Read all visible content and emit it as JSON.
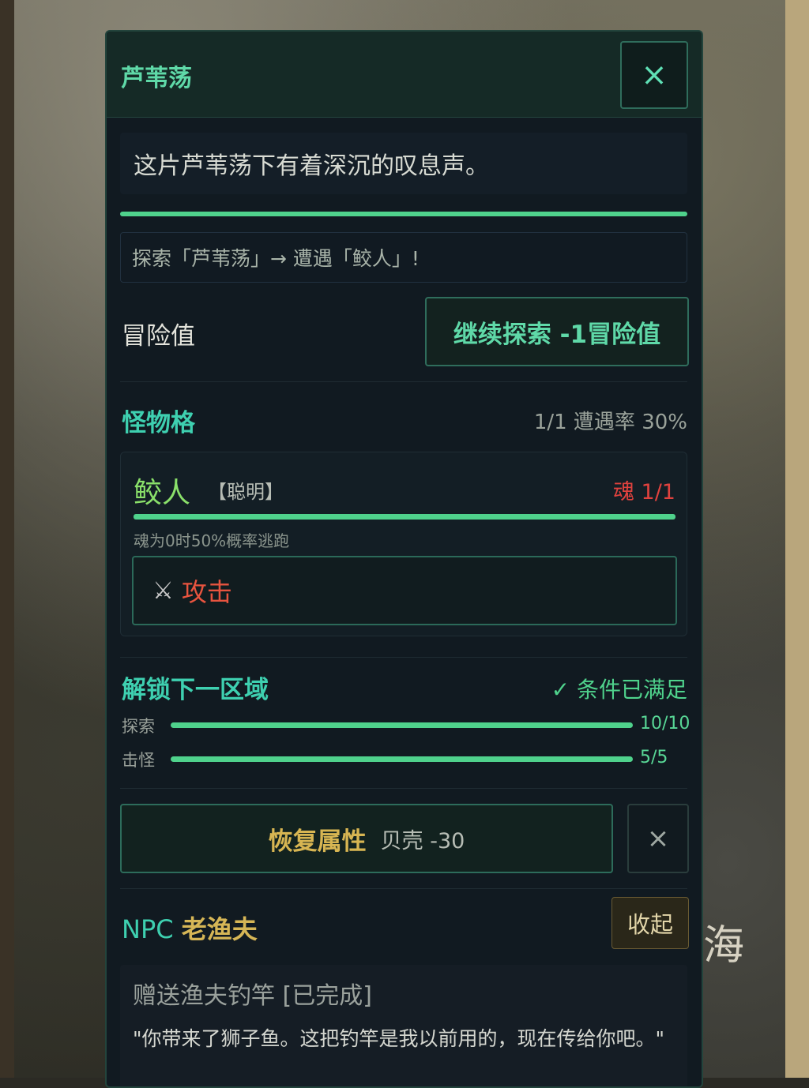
{
  "background": {
    "sea_glyph": "海"
  },
  "panel": {
    "title": "芦苇荡",
    "close_icon": "×",
    "description": "这片芦苇荡下有着深沉的叹息声。",
    "log": "探索「芦苇荡」→ 遭遇「鲛人」!",
    "adventure_label": "冒险值",
    "continue_button": "继续探索  -1冒险值"
  },
  "monster_section": {
    "title": "怪物格",
    "meta": "1/1  遭遇率 30%",
    "monster": {
      "name": "鲛人",
      "trait": "【聪明】",
      "soul": "魂 1/1",
      "soul_fraction": 1.0,
      "note": "魂为0时50%概率逃跑",
      "attack_icon": "⚔",
      "attack_label": "攻击"
    }
  },
  "unlock_section": {
    "title": "解锁下一区域",
    "status": "✓ 条件已满足",
    "rows": [
      {
        "label": "探索",
        "value": "10/10",
        "fraction": 1.0
      },
      {
        "label": "击怪",
        "value": "5/5",
        "fraction": 1.0
      }
    ]
  },
  "restore": {
    "label": "恢复属性",
    "cost": "贝壳 -30",
    "close_icon": "×"
  },
  "npc": {
    "prefix": "NPC",
    "name": "老渔夫",
    "collapse_button": "收起",
    "quest_title": "赠送渔夫钓竿 [已完成]",
    "quest_text": "\"你带来了狮子鱼。这把钓竿是我以前用的，现在传给你吧。\""
  },
  "colors": {
    "accent_green": "#4fd28c",
    "title_teal": "#3ed0b0",
    "soul_red": "#e0423e",
    "gold": "#d7b552"
  }
}
